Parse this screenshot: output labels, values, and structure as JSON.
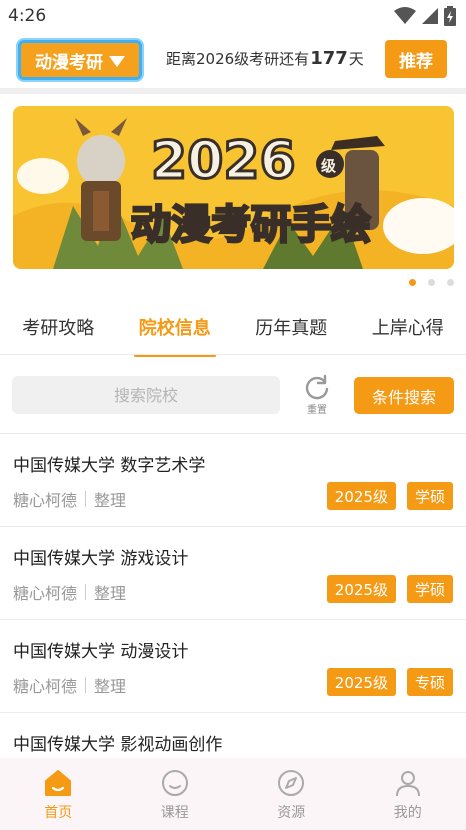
{
  "status_bar": {
    "time": "4:26"
  },
  "header": {
    "brand_label": "动漫考研",
    "countdown_prefix": "距离2026级考研还有",
    "countdown_days": "177",
    "countdown_suffix": "天",
    "recommend_label": "推荐"
  },
  "banner": {
    "title": "动漫考研手绘",
    "year": "2026",
    "year_suffix": "级",
    "dot_count": 3,
    "active_dot": 0
  },
  "tabs": [
    {
      "label": "考研攻略",
      "active": false
    },
    {
      "label": "院校信息",
      "active": true
    },
    {
      "label": "历年真题",
      "active": false
    },
    {
      "label": "上岸心得",
      "active": false
    }
  ],
  "search": {
    "placeholder": "搜索院校",
    "reset_label": "重置",
    "filter_label": "条件搜索"
  },
  "items": [
    {
      "title": "中国传媒大学 数字艺术学",
      "author": "糖心柯德",
      "role": "整理",
      "year_tag": "2025级",
      "degree_tag": "学硕"
    },
    {
      "title": "中国传媒大学 游戏设计",
      "author": "糖心柯德",
      "role": "整理",
      "year_tag": "2025级",
      "degree_tag": "学硕"
    },
    {
      "title": "中国传媒大学 动漫设计",
      "author": "糖心柯德",
      "role": "整理",
      "year_tag": "2025级",
      "degree_tag": "专硕"
    },
    {
      "title": "中国传媒大学 影视动画创作",
      "author": "",
      "role": "",
      "year_tag": "",
      "degree_tag": ""
    }
  ],
  "bottom_nav": [
    {
      "label": "首页",
      "icon": "home-icon",
      "active": true
    },
    {
      "label": "课程",
      "icon": "smile-icon",
      "active": false
    },
    {
      "label": "资源",
      "icon": "compass-icon",
      "active": false
    },
    {
      "label": "我的",
      "icon": "user-icon",
      "active": false
    }
  ],
  "colors": {
    "accent": "#f59a15",
    "banner_bg": "#f9c431",
    "brand_border": "#3fb1f2"
  }
}
